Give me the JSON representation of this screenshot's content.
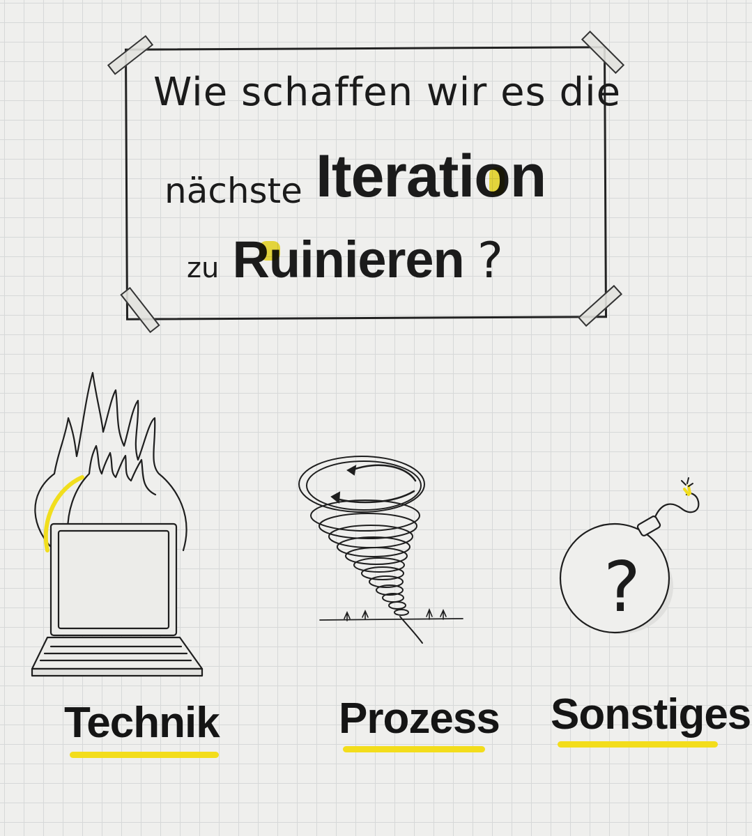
{
  "question": {
    "line1": "Wie schaffen wir es die",
    "line2_prefix": "nächste",
    "line2_emph": "Iteration",
    "line3_prefix": "zu",
    "line3_emph": "Ruinieren",
    "line3_mark": "?"
  },
  "categories": [
    {
      "label": "Technik",
      "icon": "burning-laptop-icon"
    },
    {
      "label": "Prozess",
      "icon": "tornado-icon"
    },
    {
      "label": "Sonstiges",
      "icon": "bomb-icon"
    }
  ],
  "bomb_mark": "?",
  "colors": {
    "highlight": "#f1de1e",
    "ink": "#1b1b1b",
    "paper": "#efefed",
    "grid": "#d6d8d8"
  }
}
